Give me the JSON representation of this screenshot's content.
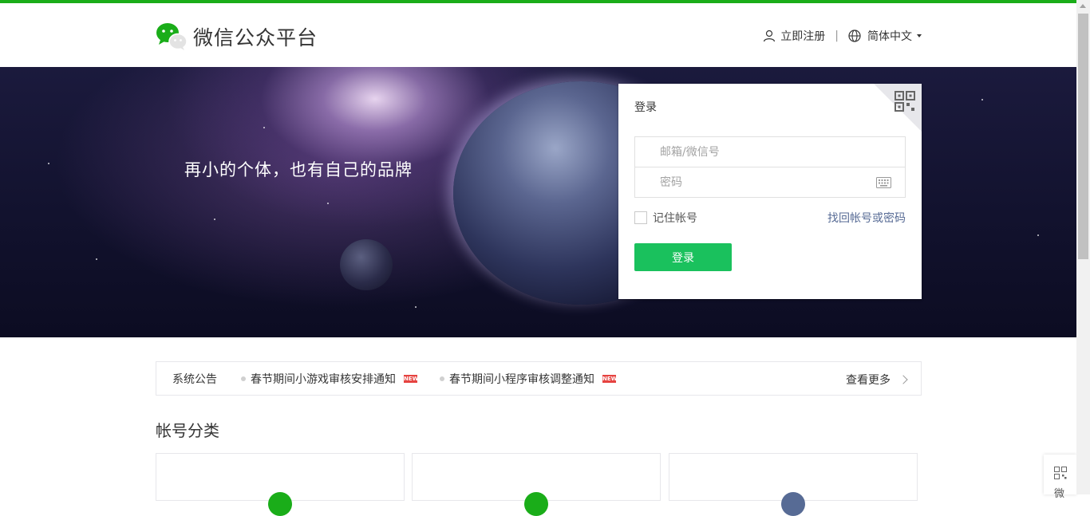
{
  "colors": {
    "brand_green": "#1aad19",
    "button_green": "#1ac15d",
    "link_blue": "#576b95",
    "new_badge": "#e64340"
  },
  "header": {
    "logo_icon": "wechat-logo-icon",
    "title": "微信公众平台",
    "register_label": "立即注册",
    "separator": "|",
    "language_label": "简体中文"
  },
  "banner": {
    "slogan": "再小的个体，也有自己的品牌"
  },
  "login": {
    "title": "登录",
    "username_placeholder": "邮箱/微信号",
    "password_placeholder": "密码",
    "remember_label": "记住帐号",
    "forgot_label": "找回帐号或密码",
    "submit_label": "登录"
  },
  "notice": {
    "label": "系统公告",
    "items": [
      {
        "text": "春节期间小游戏审核安排通知",
        "badge": "NEW"
      },
      {
        "text": "春节期间小程序审核调整通知",
        "badge": "NEW"
      }
    ],
    "more_label": "查看更多"
  },
  "categories": {
    "title": "帐号分类"
  },
  "side_float": {
    "text": "微"
  }
}
